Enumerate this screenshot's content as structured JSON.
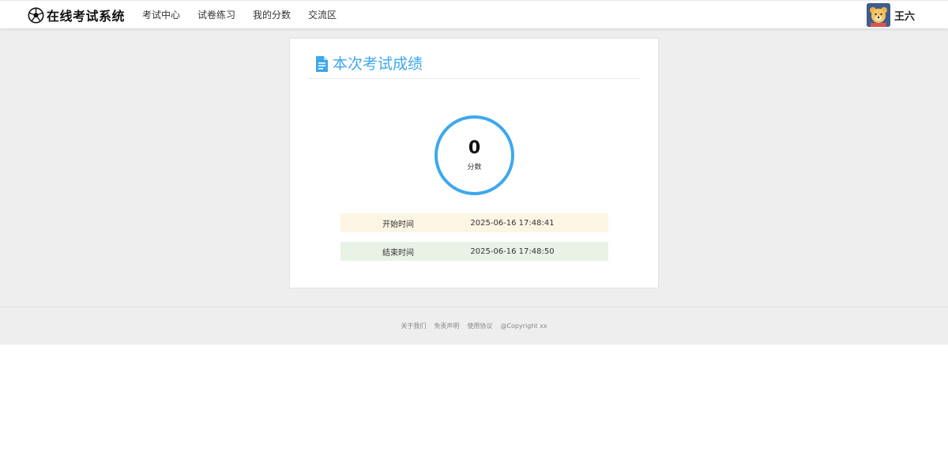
{
  "header": {
    "logo_text": "在线考试系统",
    "nav": [
      "考试中心",
      "试卷练习",
      "我的分数",
      "交流区"
    ],
    "user_name": "王六"
  },
  "result": {
    "title": "本次考试成绩",
    "score": "0",
    "score_label": "分数",
    "start_label": "开始时间",
    "start_time": "2025-06-16 17:48:41",
    "end_label": "结束时间",
    "end_time": "2025-06-16 17:48:50"
  },
  "footer": {
    "links": [
      "关于我们",
      "免责声明",
      "使用协议",
      "@Copyright xx"
    ]
  },
  "icons": {
    "logo": "soccer-ball-icon",
    "title": "document-icon",
    "avatar": "bear-avatar"
  },
  "colors": {
    "accent": "#3ea8ee",
    "start_row_bg": "#fdf5e4",
    "end_row_bg": "#e8f3e6",
    "page_bg": "#eeeeee"
  }
}
